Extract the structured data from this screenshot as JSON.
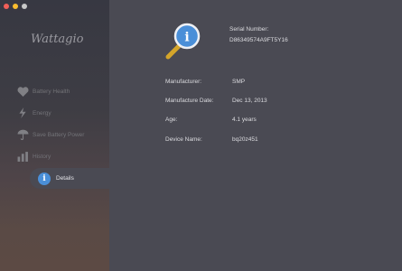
{
  "app": {
    "logo_text": "Wattagio"
  },
  "sidebar": {
    "items": [
      {
        "label": "Battery Health",
        "icon": "heart-icon"
      },
      {
        "label": "Energy",
        "icon": "lightning-icon"
      },
      {
        "label": "Save Battery Power",
        "icon": "umbrella-icon"
      },
      {
        "label": "History",
        "icon": "bar-chart-icon"
      }
    ],
    "active": {
      "label": "Details",
      "icon": "info-icon",
      "glyph": "i"
    }
  },
  "details": {
    "serial_label": "Serial Number:",
    "serial_value": "D86349574A9FT5Y16",
    "icon": "magnifier-info-icon",
    "rows": [
      {
        "key": "Manufacturer:",
        "value": "SMP"
      },
      {
        "key": "Manufacture Date:",
        "value": "Dec 13, 2013"
      },
      {
        "key": "Age:",
        "value": "4.1 years"
      },
      {
        "key": "Device Name:",
        "value": "bq20z451"
      }
    ]
  },
  "colors": {
    "accent": "#4a8fd8",
    "main_bg": "#4a4a53",
    "sidebar_text": "#737378",
    "text": "#dcdce0",
    "magnifier_handle": "#d4a52a"
  }
}
